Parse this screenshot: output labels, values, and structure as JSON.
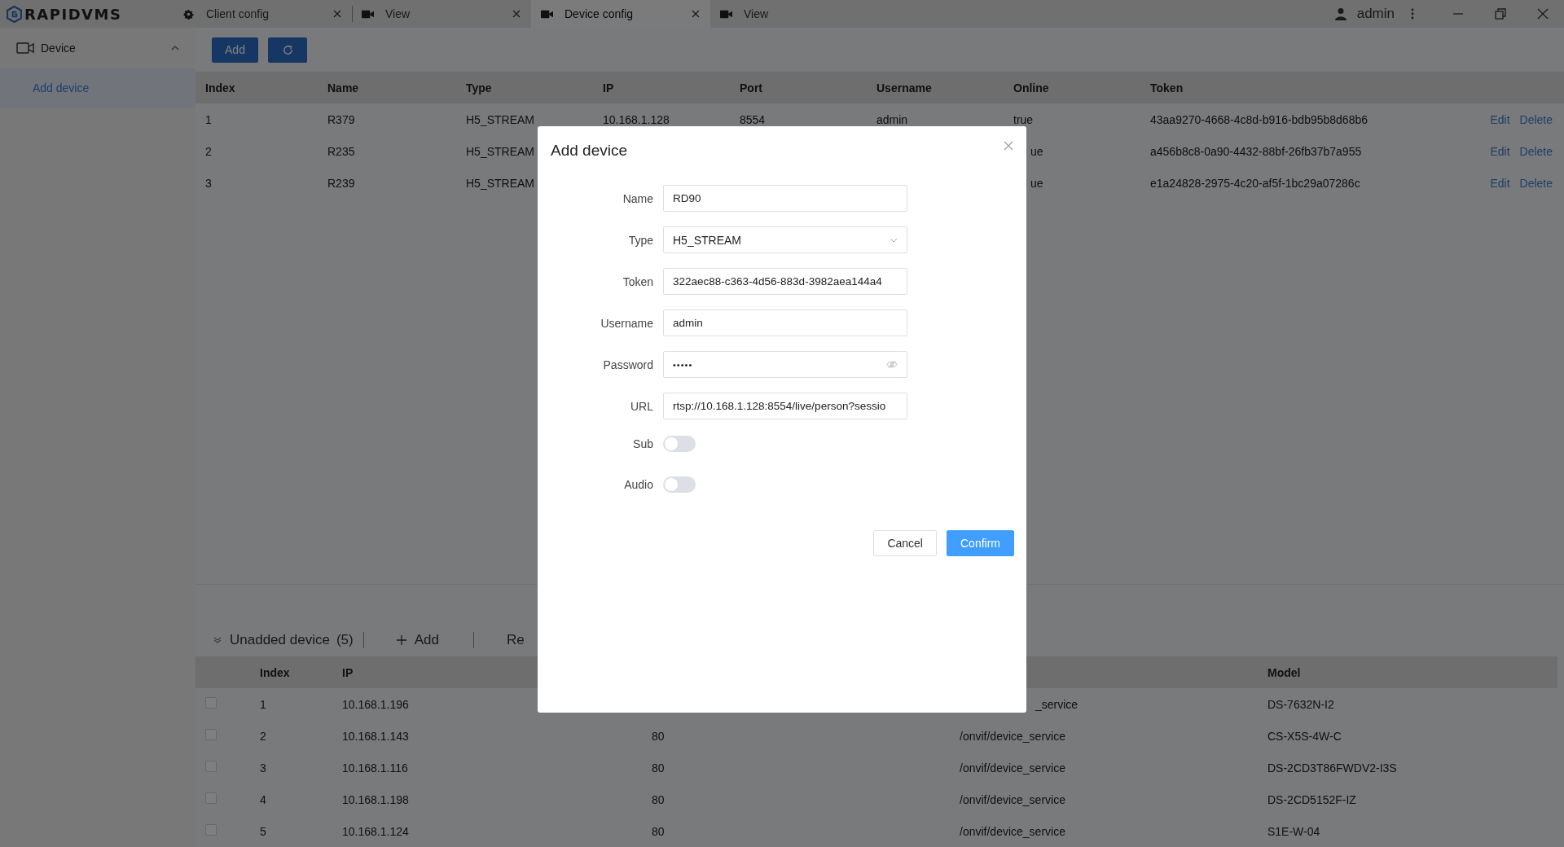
{
  "app": {
    "logo": "RAPIDVMS"
  },
  "tabs": [
    {
      "label": "Client config",
      "kind": "settings",
      "closable": true,
      "selected": false
    },
    {
      "label": "View",
      "kind": "video",
      "closable": true,
      "selected": false
    },
    {
      "label": "Device config",
      "kind": "video",
      "closable": true,
      "selected": true
    },
    {
      "label": "View",
      "kind": "video",
      "closable": false,
      "selected": false
    }
  ],
  "user": {
    "name": "admin"
  },
  "sidebar": {
    "group": {
      "label": "Device",
      "expanded": true
    },
    "items": [
      {
        "label": "Add device",
        "selected": true
      }
    ]
  },
  "toolbar": {
    "add": "Add"
  },
  "devices": {
    "columns": [
      "Index",
      "Name",
      "Type",
      "IP",
      "Port",
      "Username",
      "Online",
      "Token"
    ],
    "rows": [
      {
        "cells": [
          "1",
          "R379",
          "H5_STREAM",
          "10.168.1.128",
          "8554",
          "admin",
          "true",
          "43aa9270-4668-4c8d-b916-bdb95b8d68b6"
        ],
        "actions": [
          "Edit",
          "Delete"
        ]
      },
      {
        "cells": [
          "2",
          "R235",
          "H5_STREAM",
          null,
          null,
          null,
          {
            "text": "ue",
            "cut": true
          },
          "a456b8c8-0a90-4432-88bf-26fb37b7a955"
        ],
        "actions": [
          "Edit",
          "Delete"
        ]
      },
      {
        "cells": [
          "3",
          "R239",
          "H5_STREAM",
          null,
          null,
          null,
          {
            "text": "ue",
            "cut": true
          },
          "e1a24828-2975-4c20-af5f-1bc29a07286c"
        ],
        "actions": [
          "Edit",
          "Delete"
        ]
      }
    ]
  },
  "unadded": {
    "title": "Unadded device",
    "count": "(5)",
    "expanded": true,
    "actions": [
      {
        "label": "Add",
        "kind": "add"
      },
      {
        "label": "Re",
        "kind": "plain"
      }
    ],
    "columns": [
      "Index",
      "IP",
      null,
      null,
      "Model"
    ],
    "rows": [
      {
        "checked": false,
        "cells": [
          "1",
          "10.168.1.196",
          null,
          {
            "text": "_service",
            "cut": true
          },
          "DS-7632N-I2"
        ]
      },
      {
        "checked": false,
        "cells": [
          "2",
          "10.168.1.143",
          "80",
          "/onvif/device_service",
          "CS-X5S-4W-C"
        ]
      },
      {
        "checked": false,
        "cells": [
          "3",
          "10.168.1.116",
          "80",
          "/onvif/device_service",
          "DS-2CD3T86FWDV2-I3S"
        ]
      },
      {
        "checked": false,
        "cells": [
          "4",
          "10.168.1.198",
          "80",
          "/onvif/device_service",
          "DS-2CD5152F-IZ"
        ]
      },
      {
        "checked": false,
        "cells": [
          "5",
          "10.168.1.124",
          "80",
          "/onvif/device_service",
          "S1E-W-04"
        ]
      }
    ]
  },
  "dialog": {
    "title": "Add device",
    "fields": [
      {
        "label": "Name",
        "kind": "text",
        "value": "RD90"
      },
      {
        "label": "Type",
        "kind": "select",
        "value": "H5_STREAM"
      },
      {
        "label": "Token",
        "kind": "text",
        "value": "322aec88-c363-4d56-883d-3982aea144a4"
      },
      {
        "label": "Username",
        "kind": "text",
        "value": "admin"
      },
      {
        "label": "Password",
        "kind": "password",
        "value": "•••••"
      },
      {
        "label": "URL",
        "kind": "text",
        "value": "rtsp://10.168.1.128:8554/live/person?sessio"
      },
      {
        "label": "Sub",
        "kind": "switch",
        "on": false
      },
      {
        "label": "Audio",
        "kind": "switch",
        "on": false
      }
    ],
    "buttons": [
      {
        "label": "Cancel",
        "kind": "default"
      },
      {
        "label": "Confirm",
        "kind": "primary"
      }
    ]
  }
}
